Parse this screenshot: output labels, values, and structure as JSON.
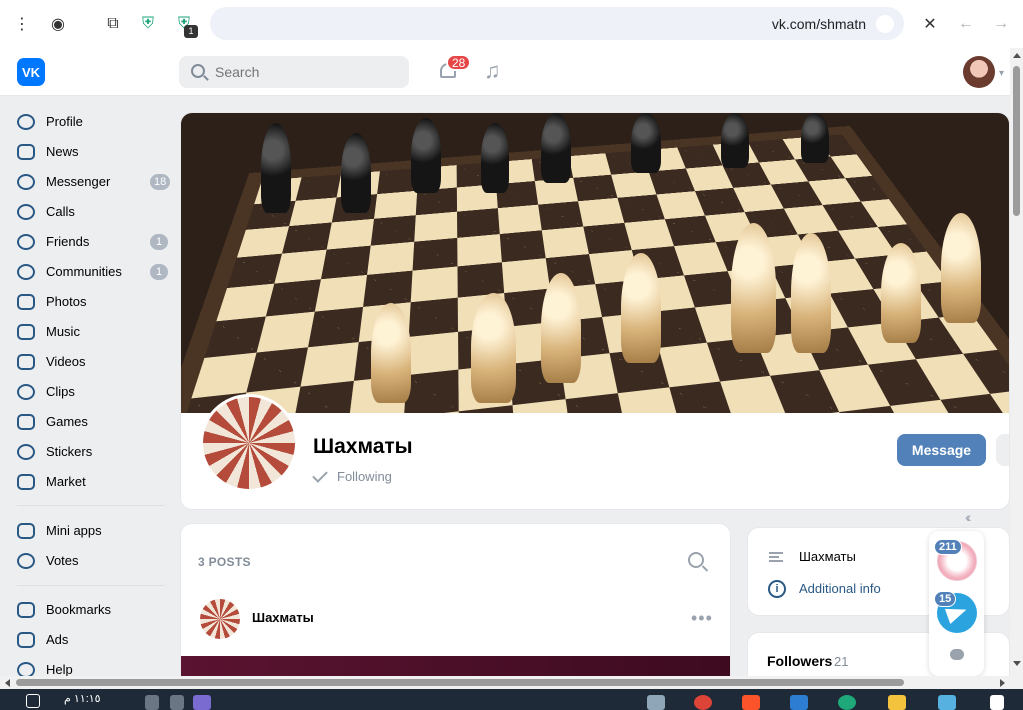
{
  "browser": {
    "url": "vk.com/shmatn",
    "extension_badge": "1"
  },
  "header": {
    "logo_text": "VK",
    "search_placeholder": "Search",
    "notifications_count": "28"
  },
  "sidebar": {
    "items": [
      {
        "label": "Profile",
        "badge": ""
      },
      {
        "label": "News",
        "badge": ""
      },
      {
        "label": "Messenger",
        "badge": "18"
      },
      {
        "label": "Calls",
        "badge": ""
      },
      {
        "label": "Friends",
        "badge": "1"
      },
      {
        "label": "Communities",
        "badge": "1"
      },
      {
        "label": "Photos",
        "badge": ""
      },
      {
        "label": "Music",
        "badge": ""
      },
      {
        "label": "Videos",
        "badge": ""
      },
      {
        "label": "Clips",
        "badge": ""
      },
      {
        "label": "Games",
        "badge": ""
      },
      {
        "label": "Stickers",
        "badge": ""
      },
      {
        "label": "Market",
        "badge": ""
      },
      {
        "label": "Mini apps",
        "badge": ""
      },
      {
        "label": "Votes",
        "badge": ""
      },
      {
        "label": "Bookmarks",
        "badge": ""
      },
      {
        "label": "Ads",
        "badge": ""
      },
      {
        "label": "Help",
        "badge": ""
      }
    ]
  },
  "group": {
    "name": "Шахматы",
    "status": "Following",
    "message_button": "Message"
  },
  "posts": {
    "title": "3 POSTS",
    "first_author": "Шахматы",
    "more": "•••"
  },
  "info": {
    "name": "Шахматы",
    "additional": "Additional info"
  },
  "followers": {
    "label": "Followers",
    "count": "21"
  },
  "chats": {
    "first_badge": "211",
    "second_badge": "15"
  },
  "taskbar": {
    "time": "١١:١٥ م"
  },
  "colors": {
    "vk_blue": "#0077ff",
    "button_blue": "#5181b8",
    "link_blue": "#2a5885",
    "notification_red": "#e64646"
  }
}
